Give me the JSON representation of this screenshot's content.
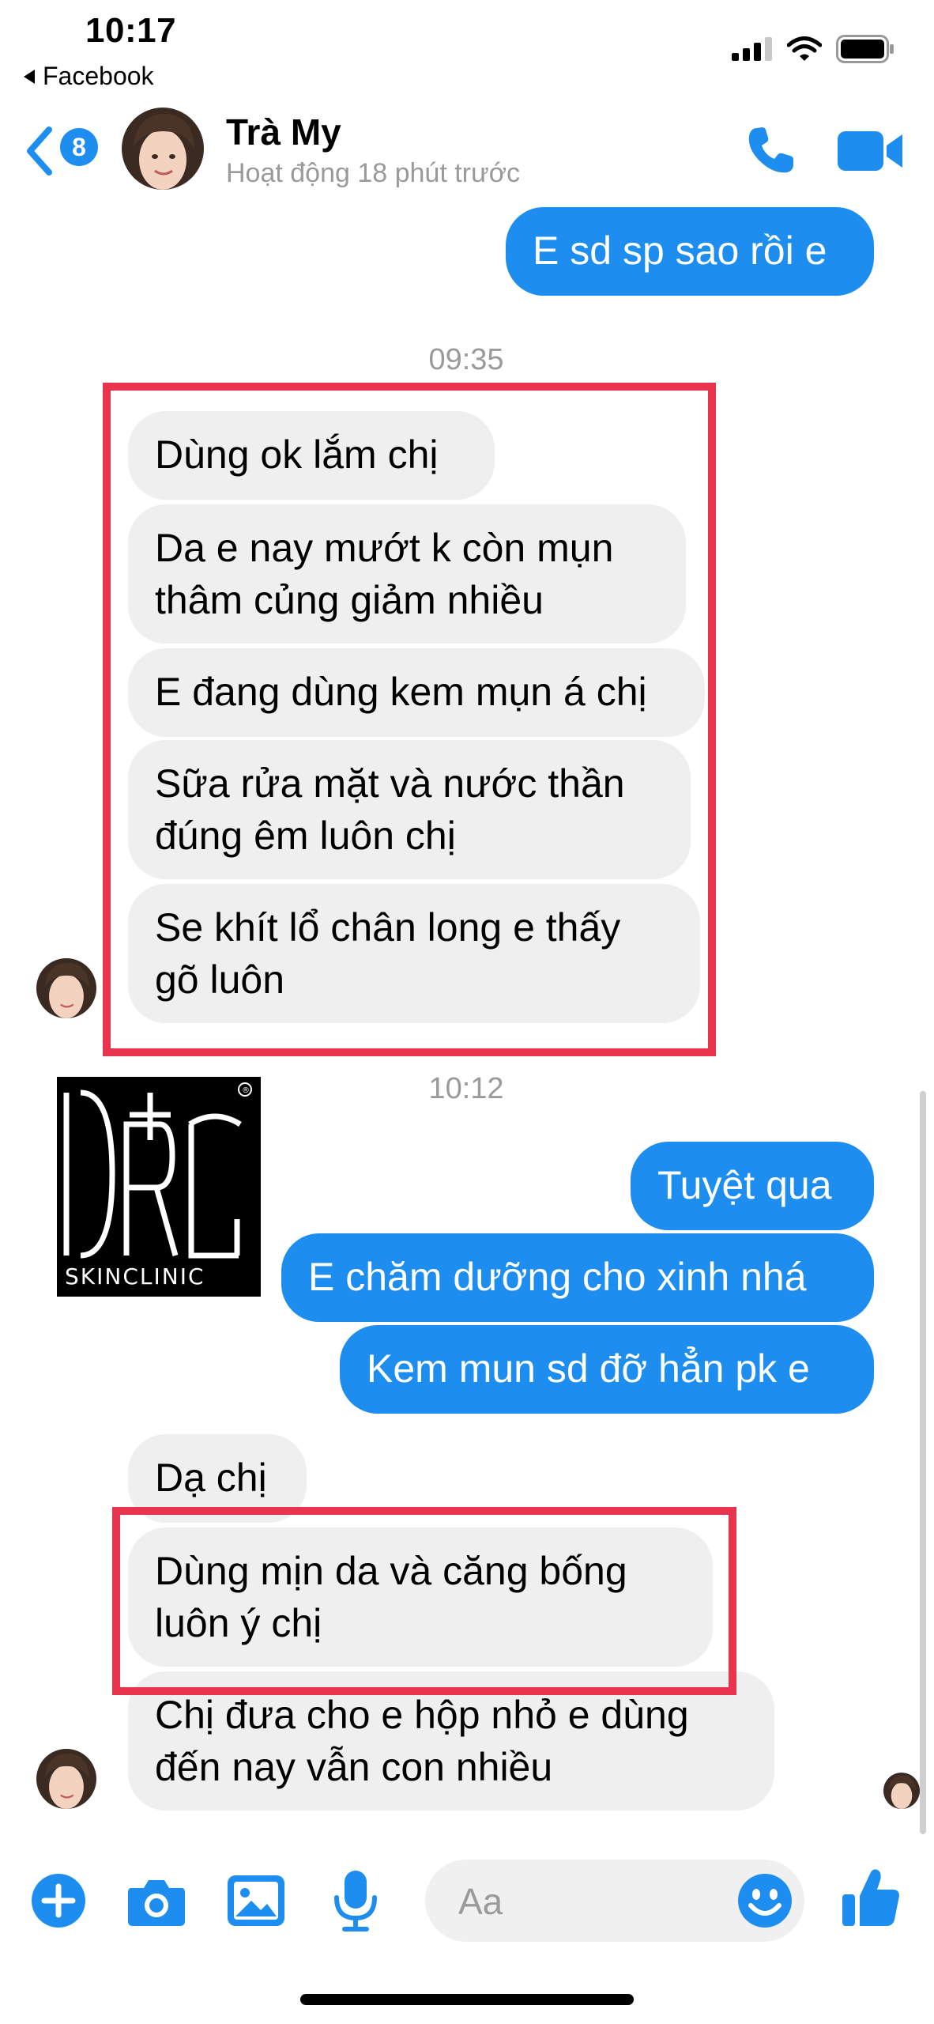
{
  "status_bar": {
    "time": "10:17",
    "back_app": "Facebook"
  },
  "header": {
    "unread_count": "8",
    "contact_name": "Trà My",
    "contact_status": "Hoạt động 18 phút trước",
    "icons": [
      "back-chevron-icon",
      "phone-icon",
      "video-camera-icon"
    ]
  },
  "timestamps": [
    "09:35",
    "10:12"
  ],
  "messages": [
    {
      "side": "out",
      "text": "E sd sp sao rồi e"
    },
    {
      "side": "in",
      "text": "Dùng ok lắm chị"
    },
    {
      "side": "in",
      "line1": "Da e nay mướt k còn mụn",
      "line2": "thâm củng giảm nhiều"
    },
    {
      "side": "in",
      "text": "E đang dùng kem mụn á chị"
    },
    {
      "side": "in",
      "line1": "Sữa rửa mặt và nước thần",
      "line2": "đúng êm luôn chị"
    },
    {
      "side": "in",
      "line1": "Se khít lổ chân long e thấy",
      "line2": "gõ luôn"
    },
    {
      "side": "out",
      "text": "Tuyệt qua"
    },
    {
      "side": "out",
      "text": "E chăm dưỡng cho xinh nhá"
    },
    {
      "side": "out",
      "text": "Kem mun sd đỡ hẳn pk e"
    },
    {
      "side": "in",
      "text": "Dạ chị"
    },
    {
      "side": "in",
      "line1": "Dùng mịn da và căng bống",
      "line2": "luôn ý chị"
    },
    {
      "side": "in",
      "line1": "Chị đưa cho e hộp nhỏ e dùng",
      "line2": "đến nay vẫn con nhiều"
    }
  ],
  "watermark_logo": {
    "mark": "DR+C",
    "sub": "SKINCLINIC",
    "registered": "®"
  },
  "composer": {
    "placeholder": "Aa",
    "icons": [
      "plus-icon",
      "camera-icon",
      "image-icon",
      "microphone-icon",
      "emoji-icon",
      "thumbs-up-icon"
    ]
  },
  "colors": {
    "accent": "#1d8ef0",
    "incoming_bubble": "#efefef",
    "highlight": "#e8344c"
  }
}
